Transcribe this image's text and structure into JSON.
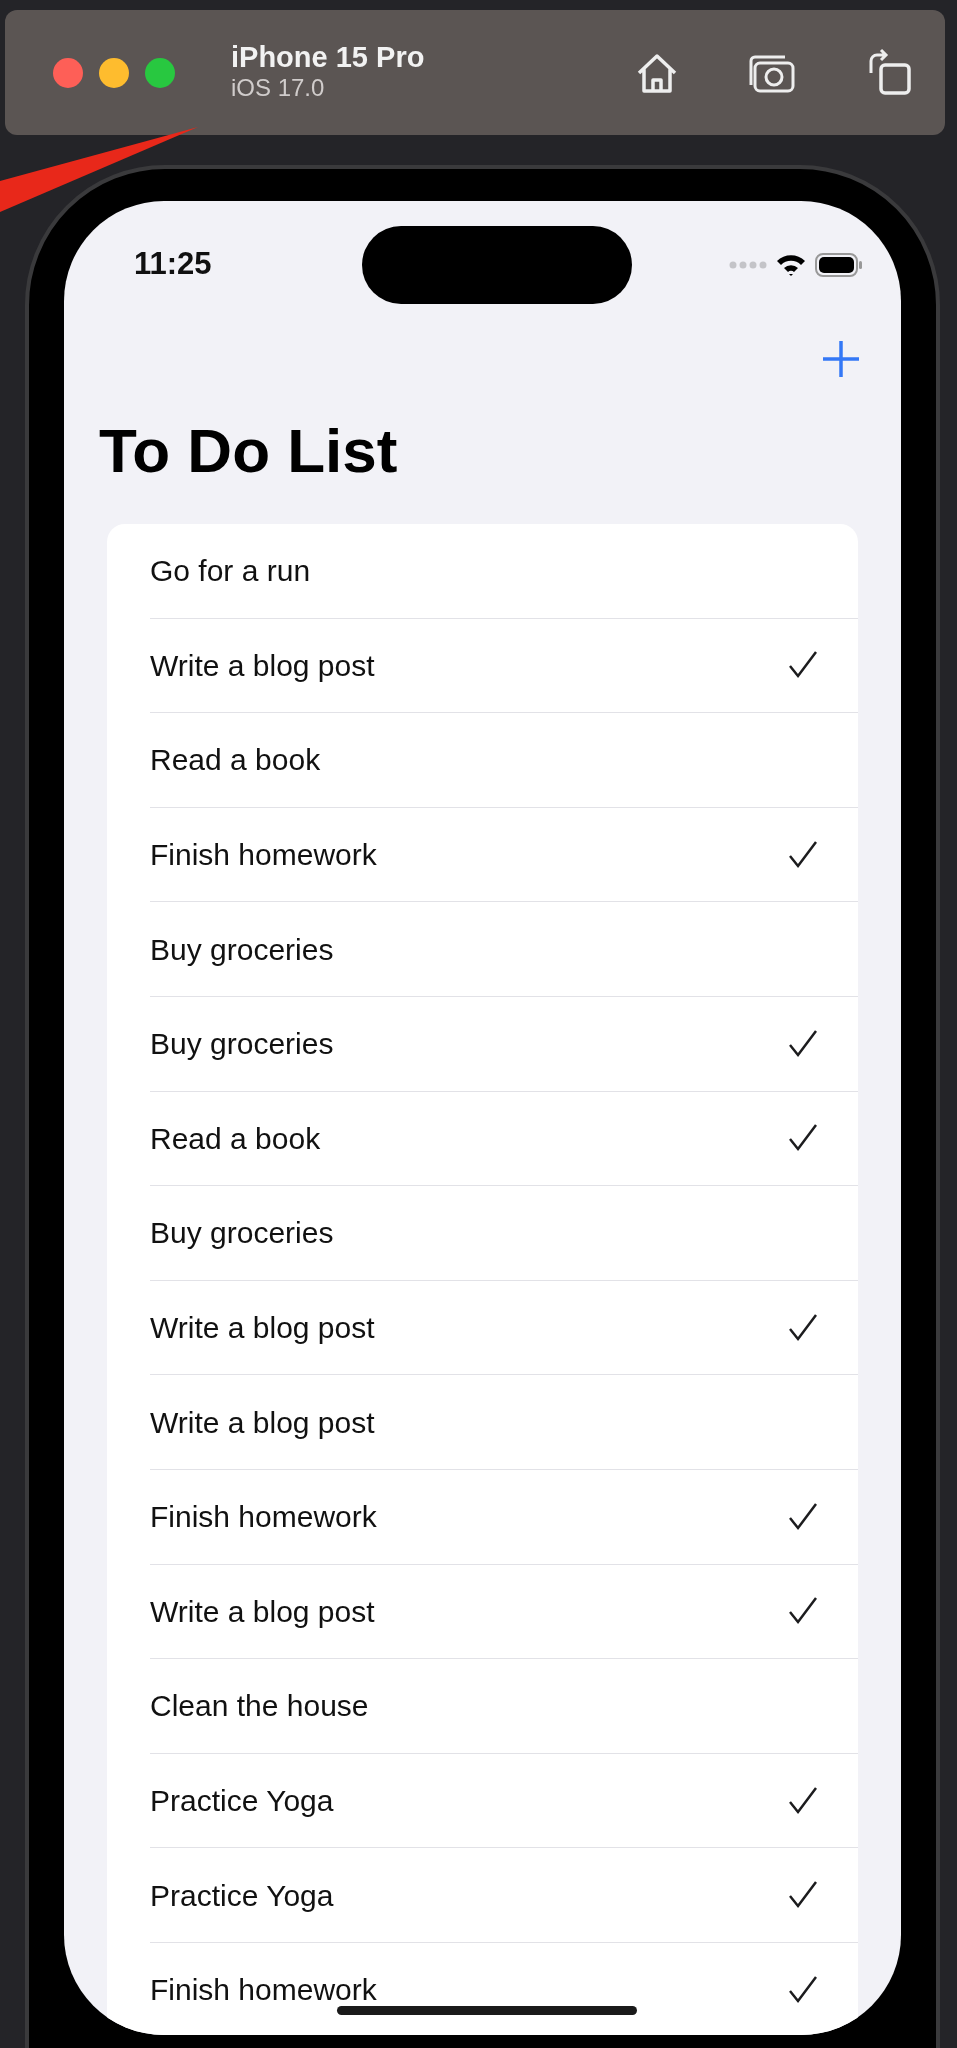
{
  "simulator": {
    "device": "iPhone 15 Pro",
    "os": "iOS 17.0"
  },
  "status_bar": {
    "time": "11:25"
  },
  "title": "To Do List",
  "items": [
    {
      "text": "Go for a run",
      "done": false
    },
    {
      "text": "Write a blog post",
      "done": true
    },
    {
      "text": "Read a book",
      "done": false
    },
    {
      "text": "Finish homework",
      "done": true
    },
    {
      "text": "Buy groceries",
      "done": false
    },
    {
      "text": "Buy groceries",
      "done": true
    },
    {
      "text": "Read a book",
      "done": true
    },
    {
      "text": "Buy groceries",
      "done": false
    },
    {
      "text": "Write a blog post",
      "done": true
    },
    {
      "text": "Write a blog post",
      "done": false
    },
    {
      "text": "Finish homework",
      "done": true
    },
    {
      "text": "Write a blog post",
      "done": true
    },
    {
      "text": "Clean the house",
      "done": false
    },
    {
      "text": "Practice Yoga",
      "done": true
    },
    {
      "text": "Practice Yoga",
      "done": true
    },
    {
      "text": "Finish homework",
      "done": true
    }
  ]
}
